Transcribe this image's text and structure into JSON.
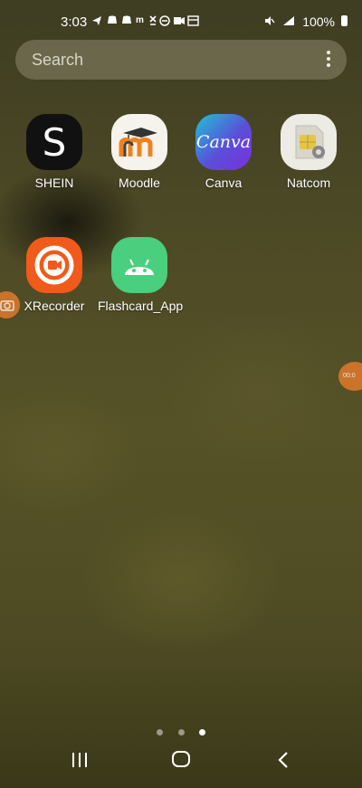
{
  "status_bar": {
    "time": "3:03",
    "notification_icons": "◄ ✈ ☺ ☻ m ✕ ⊖ ■ ▣",
    "battery": "100%"
  },
  "search": {
    "placeholder": "Search",
    "more_icon": "more-vertical-icon"
  },
  "apps": [
    {
      "label": "SHEIN",
      "glyph": "S",
      "icon": "shein-icon"
    },
    {
      "label": "Moodle",
      "icon": "moodle-icon"
    },
    {
      "label": "Canva",
      "glyph": "Canva",
      "icon": "canva-icon"
    },
    {
      "label": "Natcom",
      "icon": "natcom-icon"
    },
    {
      "label": "XRecorder",
      "icon": "xrecorder-icon"
    },
    {
      "label": "Flashcard_App",
      "icon": "android-icon"
    }
  ],
  "floating": {
    "recorder_bubble_text": "00:0"
  },
  "page_indicator": {
    "pages": 3,
    "current": 3
  },
  "navigation": {
    "recents": "recents-icon",
    "home": "home-icon",
    "back": "back-icon"
  }
}
